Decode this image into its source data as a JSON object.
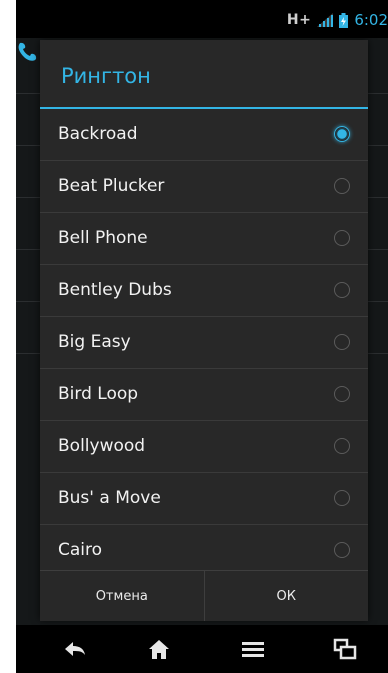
{
  "status": {
    "network": "H+",
    "time": "6:02"
  },
  "dialog": {
    "title": "Рингтон",
    "items": [
      {
        "label": "Backroad",
        "selected": true
      },
      {
        "label": "Beat Plucker",
        "selected": false
      },
      {
        "label": "Bell Phone",
        "selected": false
      },
      {
        "label": "Bentley Dubs",
        "selected": false
      },
      {
        "label": "Big Easy",
        "selected": false
      },
      {
        "label": "Bird Loop",
        "selected": false
      },
      {
        "label": "Bollywood",
        "selected": false
      },
      {
        "label": "Bus' a Move",
        "selected": false
      },
      {
        "label": "Cairo",
        "selected": false
      }
    ],
    "cancel_label": "Отмена",
    "ok_label": "ОК"
  },
  "navbar": {
    "icons": [
      "back-icon",
      "home-icon",
      "menu-icon",
      "recent-apps-icon"
    ]
  },
  "colors": {
    "accent": "#33b5e5"
  }
}
